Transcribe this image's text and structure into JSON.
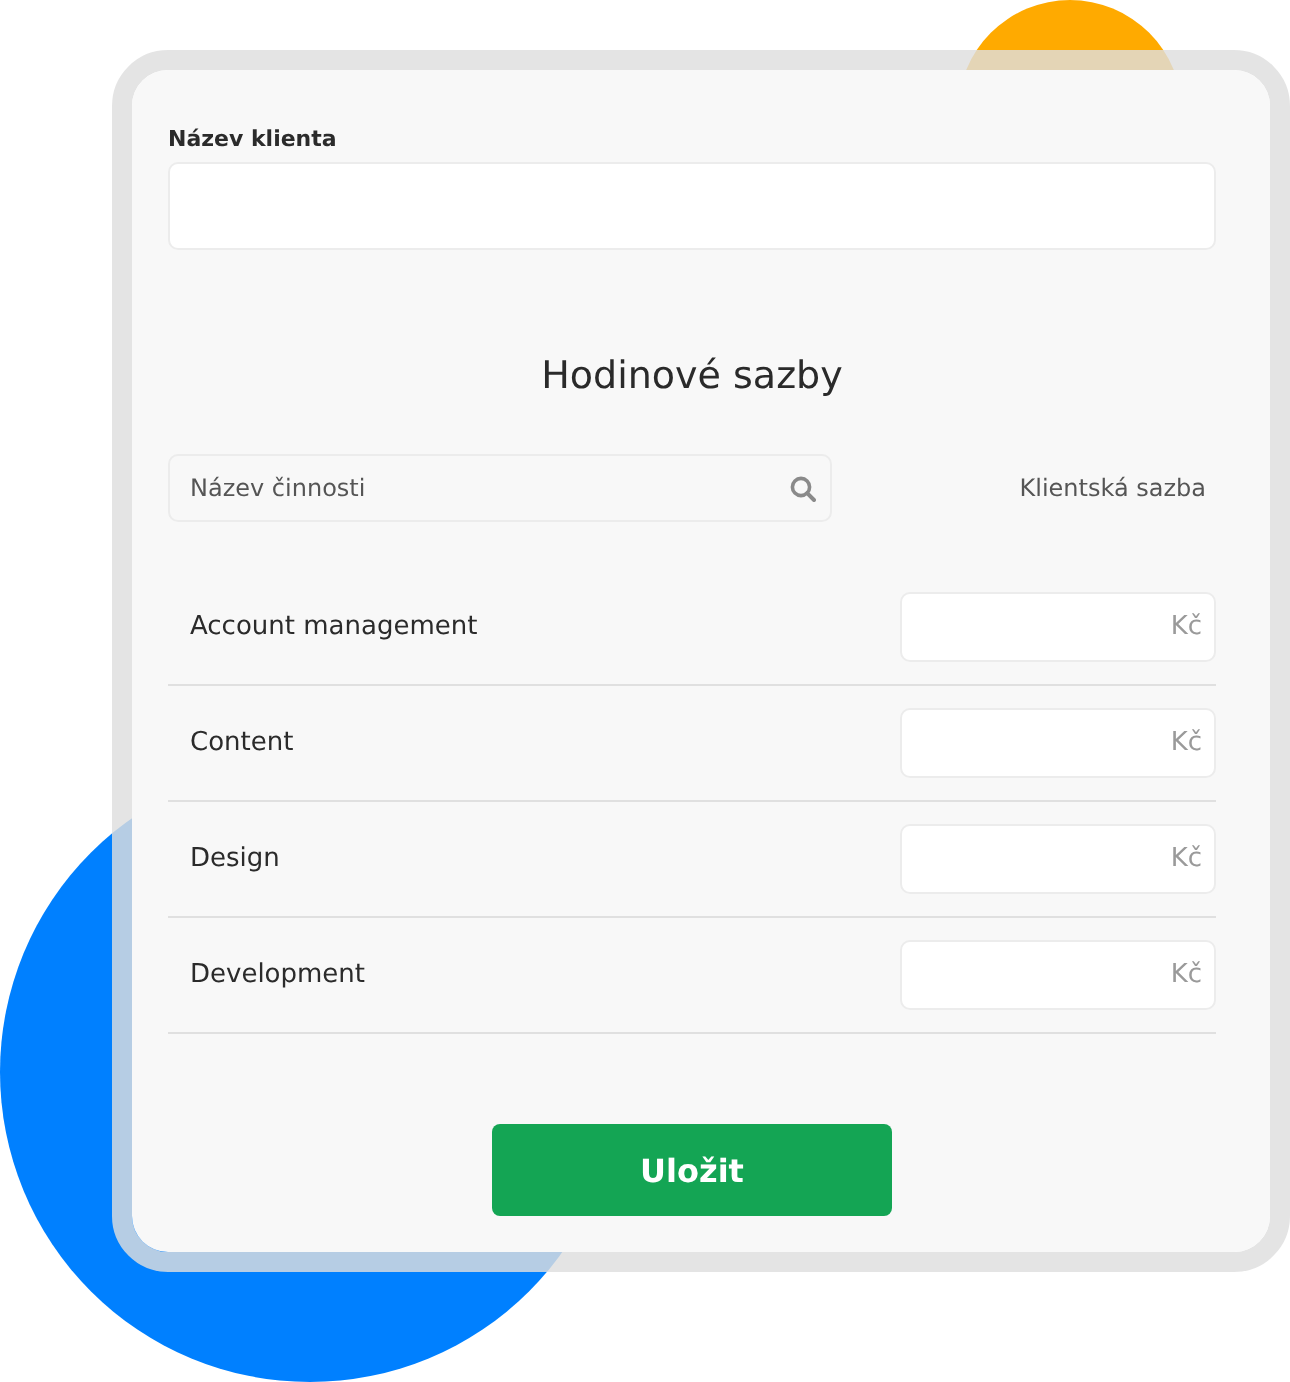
{
  "client_field": {
    "label": "Název klienta"
  },
  "rates": {
    "title": "Hodinové sazby",
    "search": {
      "placeholder": "Název činnosti"
    },
    "column_label": "Klientská sazba",
    "activities": [
      {
        "name": "Account management",
        "unit": "Kč"
      },
      {
        "name": "Content",
        "unit": "Kč"
      },
      {
        "name": "Design",
        "unit": "Kč"
      },
      {
        "name": "Development",
        "unit": "Kč"
      }
    ]
  },
  "save_button": "Uložit"
}
